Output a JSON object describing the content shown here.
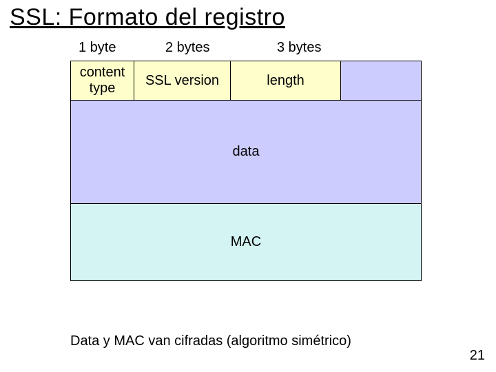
{
  "title": "SSL: Formato del registro",
  "sizes": {
    "contentType": "1 byte",
    "sslVersion": "2 bytes",
    "length": "3 bytes"
  },
  "header": {
    "contentType": "content\ntype",
    "sslVersion": "SSL version",
    "length": "length"
  },
  "sections": {
    "data": "data",
    "mac": "MAC"
  },
  "caption": "Data y MAC van cifradas (algoritmo simétrico)",
  "pageNumber": "21"
}
